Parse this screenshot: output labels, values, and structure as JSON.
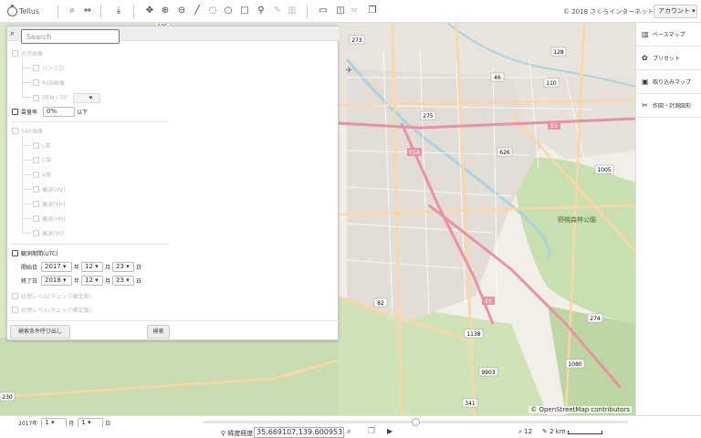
{
  "app": {
    "logo_text": "Tellus",
    "copyright": "© 2018 さくらインターネット",
    "account_label": "アカウント ▾"
  },
  "toolbar": {
    "icons": [
      "search-icon",
      "link-icon",
      "download-icon",
      "move-icon",
      "zoom-in-icon",
      "zoom-out-icon",
      "line-icon",
      "lasso-icon",
      "circle-icon",
      "rectangle-icon",
      "pin-icon",
      "edit-icon",
      "trash-icon",
      "window-icon",
      "split-view-icon",
      "chain-icon",
      "layers-icon"
    ]
  },
  "right_panel": {
    "items": [
      {
        "label": "ベースマップ",
        "icon": "map-icon"
      },
      {
        "label": "プリセット",
        "icon": "preset-icon"
      },
      {
        "label": "取り込みマップ",
        "icon": "import-icon"
      },
      {
        "label": "作図・計測図形",
        "icon": "draw-tools-icon"
      }
    ]
  },
  "search_panel": {
    "placeholder": "Search",
    "sections": {
      "optical": "光学画像",
      "optical_items": [
        "パンクロ",
        "RGB画像",
        "DEM / TIF"
      ],
      "cloud": "雲量率",
      "cloud_value": "0%",
      "cloud_suffix": "以下",
      "sar": "SAR画像",
      "sar_items": [
        "L帯",
        "C帯",
        "X帯",
        "偏波(HV)",
        "偏波(VH)",
        "偏波(HH)",
        "偏波(VV)"
      ],
      "time": "観測期間(UTC)",
      "start_label": "開始日",
      "end_label": "終了日",
      "start": {
        "year": "2017 ▾",
        "month": "12 ▾",
        "day": "23 ▾"
      },
      "end": {
        "year": "2018 ▾",
        "month": "12 ▾",
        "day": "23 ▾"
      },
      "unit_year": "年",
      "unit_month": "月",
      "unit_day": "日",
      "proc1": "処理レベル(チェック確定版)",
      "proc2": "処理レベル(チェック確定版)"
    },
    "recall_button": "検索条件呼び出し",
    "search_button": "検索"
  },
  "map": {
    "attribution": "© OpenStreetMap contributors",
    "labels": {
      "r125": "125",
      "r273": "273",
      "r128": "128",
      "r46": "46",
      "r110": "110",
      "r275": "275",
      "r626": "626",
      "r1005": "1005",
      "r82": "82",
      "r1138": "1138",
      "r274": "274",
      "r1080": "1080",
      "r9903": "9903",
      "r341": "341",
      "r230": "230",
      "e5a": "E5A",
      "e5": "E5",
      "forest": "野幌森林公園"
    }
  },
  "timeline": {
    "year": "2017年",
    "month_sel": "1 ▾",
    "month_unit": "月",
    "day_sel": "1 ▾",
    "day_unit": "日"
  },
  "status": {
    "coord_label": "緯度経度",
    "coord_value": "35.669107,139.600953",
    "zoom": "12",
    "scale": "2 km"
  }
}
